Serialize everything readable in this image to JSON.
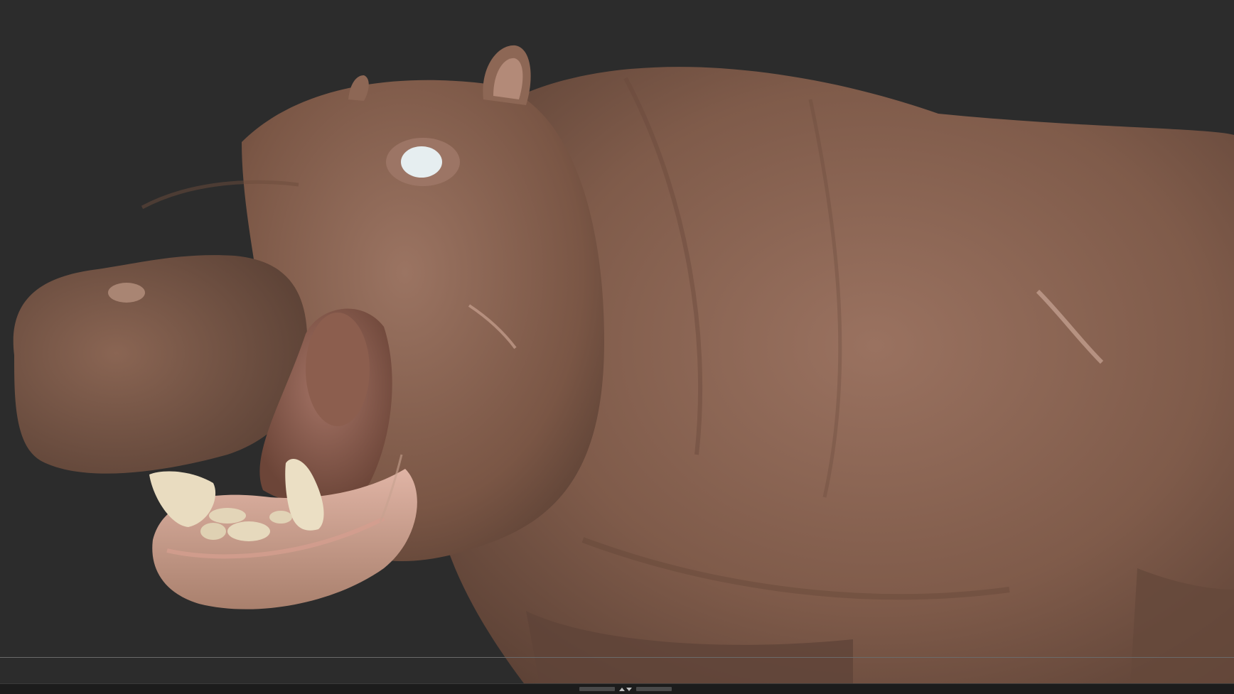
{
  "viewport": {
    "background": "#2c2c2c",
    "model": "hippopotamus-sculpt",
    "skin_color": "#8a6450",
    "teeth_color": "#e9dcc0",
    "eye_color": "#e6eef0"
  },
  "bottom_bar": {
    "toggle_icon": "collapse-expand-icon"
  }
}
